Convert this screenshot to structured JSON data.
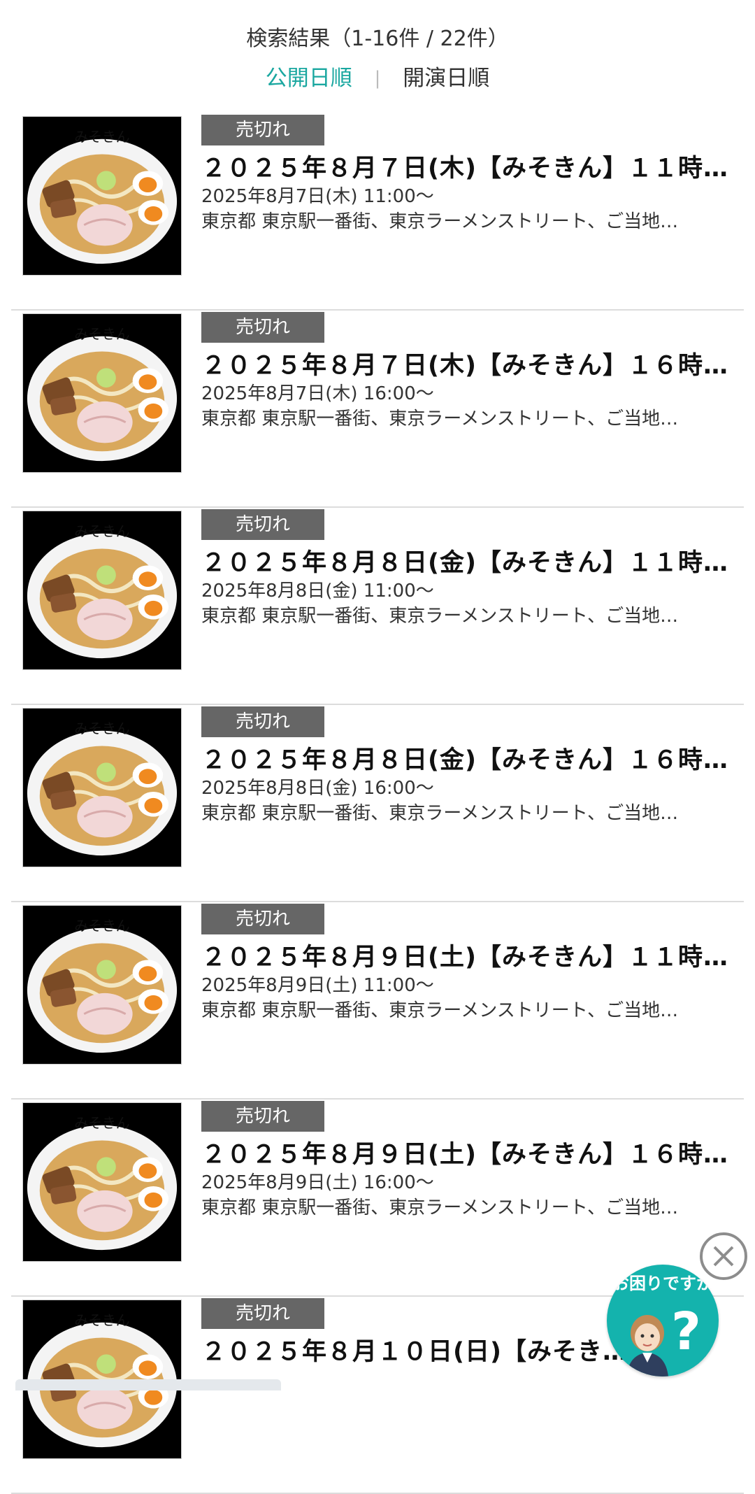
{
  "header": {
    "result_count": "検索結果（1-16件 / 22件）",
    "sort_published": "公開日順",
    "separator": "|",
    "sort_performance": "開演日順"
  },
  "items": [
    {
      "badge": "売切れ",
      "title": "２０２５年８月７日(木)【みそきん】１１時…",
      "date": "2025年8月7日(木) 11:00～",
      "venue": "東京都 東京駅一番街、東京ラーメンストリート、ご当地…"
    },
    {
      "badge": "売切れ",
      "title": "２０２５年８月７日(木)【みそきん】１６時…",
      "date": "2025年8月7日(木) 16:00～",
      "venue": "東京都 東京駅一番街、東京ラーメンストリート、ご当地…"
    },
    {
      "badge": "売切れ",
      "title": "２０２５年８月８日(金)【みそきん】１１時…",
      "date": "2025年8月8日(金) 11:00～",
      "venue": "東京都 東京駅一番街、東京ラーメンストリート、ご当地…"
    },
    {
      "badge": "売切れ",
      "title": "２０２５年８月８日(金)【みそきん】１６時…",
      "date": "2025年8月8日(金) 16:00～",
      "venue": "東京都 東京駅一番街、東京ラーメンストリート、ご当地…"
    },
    {
      "badge": "売切れ",
      "title": "２０２５年８月９日(土)【みそきん】１１時…",
      "date": "2025年8月9日(土) 11:00～",
      "venue": "東京都 東京駅一番街、東京ラーメンストリート、ご当地…"
    },
    {
      "badge": "売切れ",
      "title": "２０２５年８月９日(土)【みそきん】１６時…",
      "date": "2025年8月9日(土) 16:00～",
      "venue": "東京都 東京駅一番街、東京ラーメンストリート、ご当地…"
    },
    {
      "badge": "売切れ",
      "title": "２０２５年８月１０日(日)【みそき…",
      "date": "",
      "venue": ""
    }
  ],
  "thumbnail": {
    "brand_text": "みそきん"
  },
  "help_widget": {
    "text": "お困りですか",
    "icon": "help-question-icon",
    "close_icon": "close-icon"
  },
  "colors": {
    "accent": "#1aa7a0",
    "badge_bg": "#666666",
    "help_bg": "#14b3ad"
  }
}
